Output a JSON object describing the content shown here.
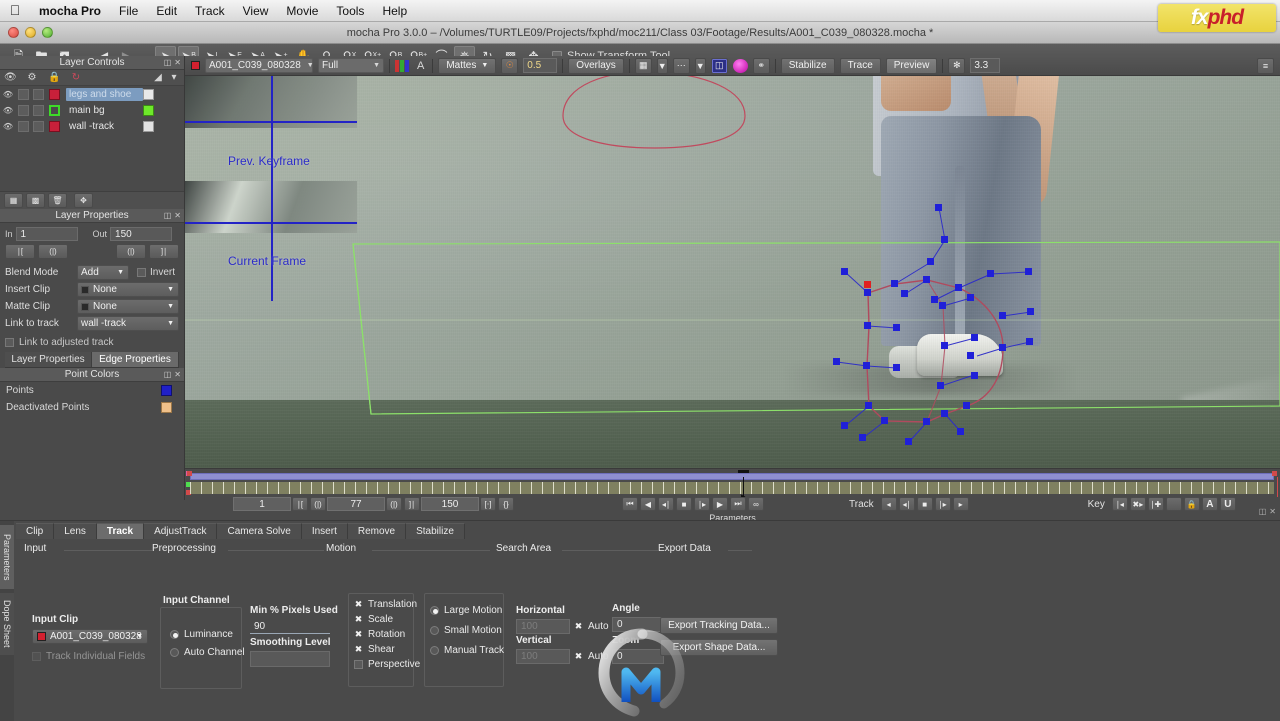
{
  "os_menu": {
    "apple_icon": "apple-icon",
    "app_name": "mocha Pro",
    "items": [
      "File",
      "Edit",
      "Track",
      "View",
      "Movie",
      "Tools",
      "Help"
    ],
    "right_icons": [
      "bluetooth-icon",
      "volume-icon",
      "wifi-icon",
      "battery-icon",
      "clock-icon",
      "spotlight-icon"
    ]
  },
  "logo": {
    "part1": "fx",
    "part2": "phd"
  },
  "window": {
    "title": "mocha Pro 3.0.0 – /Volumes/TURTLE09/Projects/fxphd/moc211/Class 03/Footage/Results/A001_C039_080328.mocha *"
  },
  "toolbar1": {
    "tools": [
      {
        "name": "new-project-icon",
        "glyph": "🗋",
        "selected": false
      },
      {
        "name": "open-project-icon",
        "glyph": "🗀",
        "selected": false
      },
      {
        "name": "save-project-icon",
        "glyph": "🖫",
        "selected": false
      },
      {
        "name": "undo-icon",
        "glyph": "◀",
        "selected": false
      },
      {
        "name": "redo-icon",
        "glyph": "▶",
        "selected": false,
        "dim": true
      },
      {
        "name": "pick-tool-icon",
        "glyph": "➤",
        "selected": true
      },
      {
        "name": "add-bezier-spline-icon",
        "glyph": "B",
        "selected": true
      },
      {
        "name": "add-xspline-icon",
        "glyph": "I",
        "selected": false
      },
      {
        "name": "add-ellipse-icon",
        "glyph": "E",
        "selected": false
      },
      {
        "name": "add-rectangle-icon",
        "glyph": "A",
        "selected": false
      },
      {
        "name": "add-point-icon",
        "glyph": "✛",
        "selected": false
      },
      {
        "name": "pan-hand-icon",
        "glyph": "✋",
        "selected": false
      },
      {
        "name": "zoom-magnifier-icon",
        "glyph": "◯",
        "selected": false
      },
      {
        "name": "link-layer-x-icon",
        "glyph": "X",
        "selected": false
      },
      {
        "name": "link-layer-xplus-icon",
        "glyph": "X+",
        "selected": false
      },
      {
        "name": "link-layer-b-icon",
        "glyph": "B",
        "selected": false
      },
      {
        "name": "link-layer-bplus-icon",
        "glyph": "B+",
        "selected": false
      },
      {
        "name": "spline-curve-icon",
        "glyph": "⌒",
        "selected": false
      },
      {
        "name": "magnetic-spline-icon",
        "glyph": "✥",
        "selected": true
      },
      {
        "name": "rotate-tool-icon",
        "glyph": "↻",
        "selected": false
      },
      {
        "name": "align-surface-icon",
        "glyph": "▣",
        "selected": false
      },
      {
        "name": "move-transform-icon",
        "glyph": "✥",
        "selected": false
      }
    ],
    "show_transform_label": "Show Transform Tool",
    "show_transform_checked": false
  },
  "toolbar2": {
    "clip_swatch": "#d3202f",
    "clip_name": "A001_C039_080328",
    "quality": "Full",
    "channel_icon": "rgb-channels-icon",
    "alpha_icon": "alpha-channel-icon",
    "mattes_label": "Mattes",
    "opacity_icon": "opacity-icon",
    "opacity_value": "0.5",
    "overlays_label": "Overlays",
    "surface_icon": "surface-overlay-icon",
    "grid_icon": "grid-overlay-icon",
    "track_matte_icon": "track-matte-icon",
    "magenta_icon": "magenta-matte-icon",
    "grain_icon": "grain-icon",
    "stabilize_label": "Stabilize",
    "trace_label": "Trace",
    "preview_label": "Preview",
    "zoom_icon": "zoom-fit-icon",
    "zoom_value": "3.3",
    "panel_menu_icon": "panel-menu-icon"
  },
  "layer_controls": {
    "title": "Layer Controls",
    "header_icons": [
      "float-panel-icon",
      "close-panel-icon"
    ],
    "column_icons": [
      "visibility-icon",
      "gear-icon",
      "lock-icon",
      "refresh-icon",
      "color-picker-icon",
      "layer-menu-icon"
    ],
    "layers": [
      {
        "name": "legs and shoe",
        "color": "#c8203a",
        "outline": false,
        "end_color": "#e8e8e8",
        "selected": true
      },
      {
        "name": "main bg",
        "color": "#3ddb28",
        "outline": true,
        "end_color": "#6ee82a",
        "selected": false
      },
      {
        "name": "wall -track",
        "color": "#c8203a",
        "outline": false,
        "end_color": "#e3e3e3",
        "selected": false
      }
    ]
  },
  "layer_properties": {
    "title": "Layer Properties",
    "header_icons": [
      "float-panel-icon",
      "close-panel-icon"
    ],
    "toolbar_icons": [
      "add-layer-icon",
      "duplicate-layer-icon",
      "delete-layer-icon",
      "fit-layer-icon"
    ],
    "in_label": "In",
    "in_value": "1",
    "out_label": "Out",
    "out_value": "150",
    "clip_buttons": [
      "set-in-icon",
      "step-back-icon",
      "step-fwd-icon",
      "set-out-icon"
    ],
    "blend_mode_label": "Blend Mode",
    "blend_mode_value": "Add",
    "invert_label": "Invert",
    "invert_checked": false,
    "insert_clip_label": "Insert Clip",
    "insert_clip_value": "None",
    "matte_clip_label": "Matte Clip",
    "matte_clip_value": "None",
    "link_to_track_label": "Link to track",
    "link_to_track_value": "wall -track",
    "link_adjusted_label": "Link to adjusted track",
    "link_adjusted_checked": false,
    "tabs": [
      {
        "label": "Layer Properties",
        "active": false
      },
      {
        "label": "Edge Properties",
        "active": true
      }
    ]
  },
  "point_colors": {
    "title": "Point Colors",
    "header_icons": [
      "float-panel-icon",
      "close-panel-icon"
    ],
    "rows": [
      {
        "label": "Points",
        "color": "#2020c8"
      },
      {
        "label": "Deactivated Points",
        "color": "#efc08a"
      }
    ]
  },
  "viewer": {
    "prev_keyframe_label": "Prev. Keyframe",
    "current_frame_label": "Current Frame",
    "overlay_point_color": "#2020d8",
    "spline_color": "#b04a5e",
    "bg_layer_color": "#8ce06a"
  },
  "timeline": {
    "in_frame": "1",
    "current_frame": "77",
    "out_frame": "150",
    "set_in_icons": [
      "set-in-point-icon",
      "prev-keyframe-icon"
    ],
    "set_out_icons": [
      "next-keyframe-icon",
      "set-out-point-icon"
    ],
    "bracket_icons": [
      "zoom-timeline-in-icon",
      "zoom-timeline-out-icon"
    ],
    "transport_icons": [
      "go-to-start-icon",
      "play-backward-icon",
      "step-backward-icon",
      "stop-icon",
      "step-forward-icon",
      "play-forward-icon",
      "go-to-end-icon",
      "loop-icon"
    ],
    "track_label": "Track",
    "track_icons": [
      "track-backward-icon",
      "track-back-frame-icon",
      "track-stop-icon",
      "track-fwd-frame-icon",
      "track-forward-icon"
    ],
    "key_label": "Key",
    "key_icons": [
      "prev-key-icon",
      "delete-key-icon",
      "add-key-icon",
      "blank-icon",
      "key-lock-icon",
      "auto-key-a-icon",
      "auto-key-u-icon"
    ],
    "parameters_label": "Parameters"
  },
  "bottom_panel": {
    "vertical_tabs": [
      {
        "label": "Parameters",
        "active": true
      },
      {
        "label": "Dope Sheet",
        "active": false
      }
    ],
    "tabs": [
      {
        "label": "Clip",
        "active": false
      },
      {
        "label": "Lens",
        "active": false
      },
      {
        "label": "Track",
        "active": true
      },
      {
        "label": "AdjustTrack",
        "active": false
      },
      {
        "label": "Camera Solve",
        "active": false
      },
      {
        "label": "Insert",
        "active": false
      },
      {
        "label": "Remove",
        "active": false
      },
      {
        "label": "Stabilize",
        "active": false
      }
    ],
    "groups": [
      "Input",
      "Preprocessing",
      "Motion",
      "Search Area",
      "Export Data"
    ],
    "input_clip_label": "Input Clip",
    "input_clip_swatch": "#d3202f",
    "input_clip_value": "A001_C039_080328",
    "track_fields_label": "Track Individual Fields",
    "track_fields_checked": false,
    "track_fields_disabled": true,
    "input_channel_label": "Input Channel",
    "input_channel_options": [
      {
        "label": "Luminance",
        "selected": true
      },
      {
        "label": "Auto Channel",
        "selected": false
      }
    ],
    "min_pixels_label": "Min % Pixels Used",
    "min_pixels_value": "90",
    "smoothing_label": "Smoothing Level",
    "smoothing_value": "",
    "motion_checkboxes": [
      {
        "label": "Translation",
        "checked": true
      },
      {
        "label": "Scale",
        "checked": true
      },
      {
        "label": "Rotation",
        "checked": true
      },
      {
        "label": "Shear",
        "checked": true
      },
      {
        "label": "Perspective",
        "checked": false
      }
    ],
    "motion_modes": [
      {
        "label": "Large Motion",
        "selected": true
      },
      {
        "label": "Small Motion",
        "selected": false
      },
      {
        "label": "Manual Track",
        "selected": false
      }
    ],
    "horizontal_label": "Horizontal",
    "horizontal_value": "100",
    "horizontal_auto_label": "Auto",
    "horizontal_auto_checked": true,
    "vertical_label": "Vertical",
    "vertical_value": "100",
    "vertical_auto_label": "Auto",
    "vertical_auto_checked": true,
    "angle_label": "Angle",
    "angle_value": "0",
    "zoom_label": "Zoom",
    "zoom_value": "0",
    "export_tracking_label": "Export Tracking Data...",
    "export_shape_label": "Export Shape Data..."
  }
}
